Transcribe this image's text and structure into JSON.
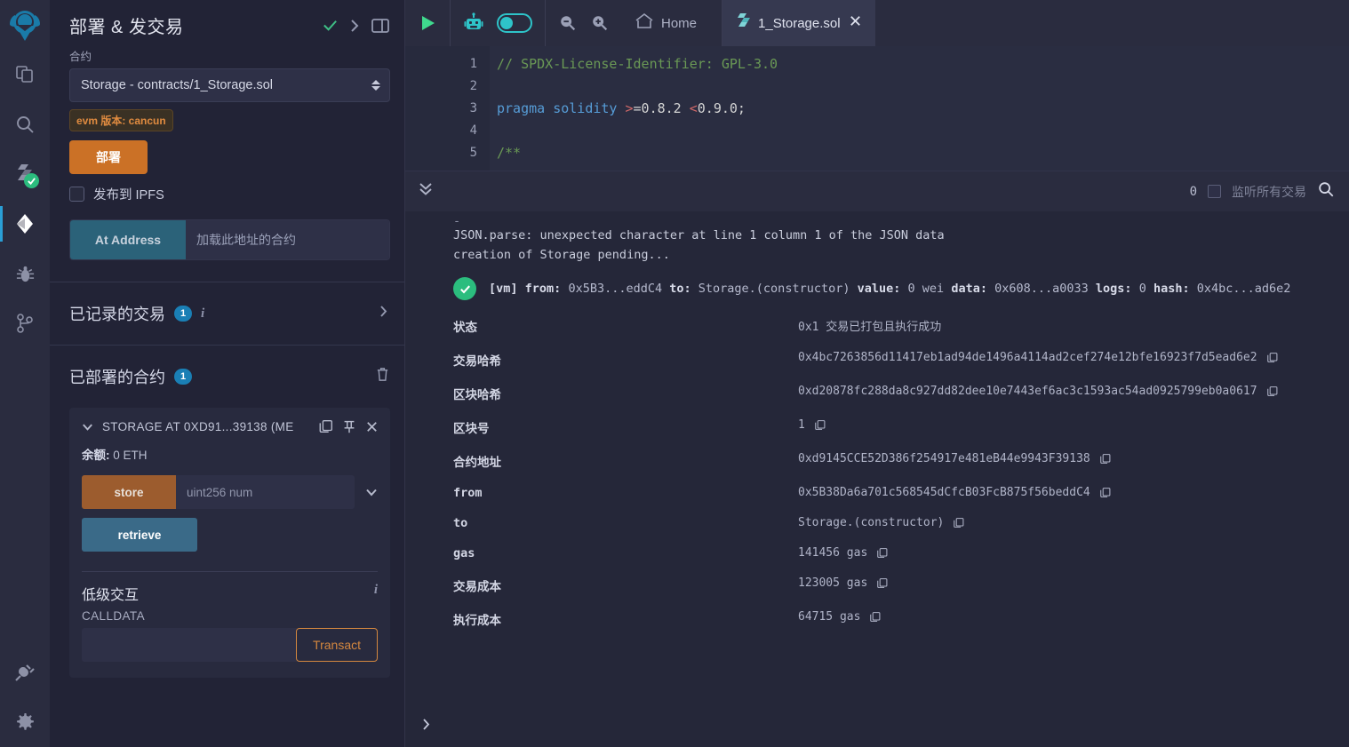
{
  "app": {
    "logo_icon": "remix-logo-icon",
    "accent_orange": "#cb7126",
    "accent_blue": "#1a7fb5",
    "success_green": "#2bbd7e"
  },
  "iconbar": {
    "items": [
      {
        "name": "file-explorer-icon",
        "glyph": "files-icon"
      },
      {
        "name": "search-icon",
        "glyph": "magnifier-icon"
      },
      {
        "name": "solidity-compiler-icon",
        "glyph": "solidity-icon",
        "badge": "check-badge"
      },
      {
        "name": "deploy-run-icon",
        "glyph": "ethereum-icon",
        "active": true
      },
      {
        "name": "debugger-icon",
        "glyph": "bug-icon"
      },
      {
        "name": "git-icon",
        "glyph": "branch-icon"
      },
      {
        "name": "plugin-manager-icon",
        "glyph": "plug-icon"
      },
      {
        "name": "settings-icon",
        "glyph": "gear-icon"
      }
    ]
  },
  "left_panel": {
    "title": "部署 & 发交易",
    "title_icons": [
      "check-icon",
      "chevron-right-icon",
      "layout-panel-icon"
    ],
    "contract": {
      "label": "合约",
      "selected": "Storage - contracts/1_Storage.sol",
      "evm_badge": "evm 版本: cancun",
      "deploy_button": "部署",
      "ipfs_checkbox_label": "发布到 IPFS",
      "ipfs_checked": false,
      "at_address_button": "At Address",
      "at_address_placeholder": "加载此地址的合约",
      "at_address_value": ""
    },
    "recorded": {
      "title": "已记录的交易",
      "count": "1",
      "info_icon": "info-icon",
      "chevron": "chevron-right-icon"
    },
    "deployed": {
      "title": "已部署的合约",
      "count": "1",
      "trash_icon": "trash-icon",
      "card": {
        "name": "STORAGE AT 0XD91...39138 (ME",
        "collapse_icon": "chevron-down-icon",
        "copy_icon": "copy-icon",
        "pin_icon": "pin-icon",
        "close_icon": "close-icon",
        "balance_label": "余额:",
        "balance_value": "0 ETH",
        "functions": [
          {
            "name": "store",
            "kind": "transact",
            "placeholder": "uint256 num",
            "value": "",
            "expand": true
          },
          {
            "name": "retrieve",
            "kind": "call"
          }
        ],
        "lowlevel": {
          "title": "低级交互",
          "info_icon": "info-icon",
          "calldata_label": "CALLDATA",
          "calldata_value": "",
          "transact_button": "Transact"
        }
      }
    }
  },
  "topbar": {
    "run_icon": "play-icon",
    "ai_icon": "robot-icon",
    "ai_toggle_on": true,
    "zoom_out_icon": "zoom-out-icon",
    "zoom_in_icon": "zoom-in-icon",
    "home_icon": "home-icon",
    "home_label": "Home",
    "tabs": [
      {
        "label": "1_Storage.sol",
        "icon": "solidity-file-icon",
        "active": true,
        "close_icon": "close-icon"
      }
    ]
  },
  "editor": {
    "lines": [
      {
        "no": "1",
        "tokens": [
          {
            "t": "// SPDX-License-Identifier: GPL-3.0",
            "c": "c-comment"
          }
        ]
      },
      {
        "no": "2",
        "tokens": []
      },
      {
        "no": "3",
        "tokens": [
          {
            "t": "pragma",
            "c": "c-kw"
          },
          {
            "t": " ",
            "c": "c-plain"
          },
          {
            "t": "solidity",
            "c": "c-kw"
          },
          {
            "t": " ",
            "c": "c-plain"
          },
          {
            "t": ">",
            "c": "c-op"
          },
          {
            "t": "=0.8.2 ",
            "c": "c-plain"
          },
          {
            "t": "<",
            "c": "c-op"
          },
          {
            "t": "0.9.0;",
            "c": "c-plain"
          }
        ]
      },
      {
        "no": "4",
        "tokens": []
      },
      {
        "no": "5",
        "tokens": [
          {
            "t": "/**",
            "c": "c-comment"
          }
        ]
      }
    ]
  },
  "terminal": {
    "header": {
      "collapse_icon": "chevrons-down-icon",
      "count": "0",
      "listen_checkbox_label": "监听所有交易",
      "listen_checked": false,
      "search_icon": "search-icon"
    },
    "logs": [
      "JSON.parse: unexpected character at line 1 column 1 of the JSON data",
      "creation of Storage pending..."
    ],
    "transaction": {
      "status_icon": "check-circle-icon",
      "summary": {
        "vm": "[vm]",
        "from_label": "from:",
        "from_value": "0x5B3...eddC4",
        "to_label": "to:",
        "to_value": "Storage.(constructor)",
        "value_label": "value:",
        "value_value": "0 wei",
        "data_label": "data:",
        "data_value": "0x608...a0033",
        "logs_label": "logs:",
        "logs_value": "0",
        "hash_label": "hash:",
        "hash_value": "0x4bc...ad6e2"
      },
      "rows": [
        {
          "key": "状态",
          "value": "0x1 交易已打包且执行成功",
          "copy": false
        },
        {
          "key": "交易哈希",
          "value": "0x4bc7263856d11417eb1ad94de1496a4114ad2cef274e12bfe16923f7d5ead6e2",
          "copy": true
        },
        {
          "key": "区块哈希",
          "value": "0xd20878fc288da8c927dd82dee10e7443ef6ac3c1593ac54ad0925799eb0a0617",
          "copy": true
        },
        {
          "key": "区块号",
          "value": "1",
          "copy": true
        },
        {
          "key": "合约地址",
          "value": "0xd9145CCE52D386f254917e481eB44e9943F39138",
          "copy": true
        },
        {
          "key": "from",
          "value": "0x5B38Da6a701c568545dCfcB03FcB875f56beddC4",
          "copy": true
        },
        {
          "key": "to",
          "value": "Storage.(constructor)",
          "copy": true
        },
        {
          "key": "gas",
          "value": "141456 gas",
          "copy": true
        },
        {
          "key": "交易成本",
          "value": "123005 gas",
          "copy": true
        },
        {
          "key": "执行成本",
          "value": "64715 gas",
          "copy": true
        }
      ]
    },
    "footer_prompt_icon": "chevron-right-icon"
  }
}
